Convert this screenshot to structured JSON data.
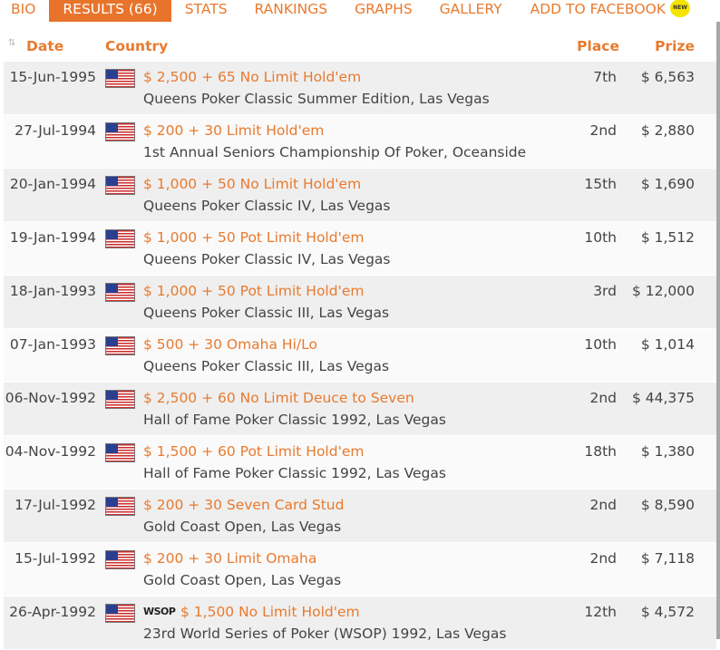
{
  "tabs": [
    {
      "label": "BIO"
    },
    {
      "label": "RESULTS (66)"
    },
    {
      "label": "STATS"
    },
    {
      "label": "RANKINGS"
    },
    {
      "label": "GRAPHS"
    },
    {
      "label": "GALLERY"
    },
    {
      "label": "ADD TO FACEBOOK"
    }
  ],
  "new_badge": "NEW",
  "headers": {
    "date": "Date",
    "country": "Country",
    "place": "Place",
    "prize": "Prize"
  },
  "rows": [
    {
      "date": "15-Jun-1995",
      "event": "$ 2,500 + 65 No Limit Hold'em",
      "venue": "Queens Poker Classic Summer Edition, Las Vegas",
      "place": "7th",
      "prize": "$ 6,563"
    },
    {
      "date": "27-Jul-1994",
      "event": "$ 200 + 30 Limit Hold'em",
      "venue": "1st Annual Seniors Championship Of Poker, Oceanside",
      "place": "2nd",
      "prize": "$ 2,880"
    },
    {
      "date": "20-Jan-1994",
      "event": "$ 1,000 + 50 No Limit Hold'em",
      "venue": "Queens Poker Classic IV, Las Vegas",
      "place": "15th",
      "prize": "$ 1,690"
    },
    {
      "date": "19-Jan-1994",
      "event": "$ 1,000 + 50 Pot Limit Hold'em",
      "venue": "Queens Poker Classic IV, Las Vegas",
      "place": "10th",
      "prize": "$ 1,512"
    },
    {
      "date": "18-Jan-1993",
      "event": "$ 1,000 + 50 Pot Limit Hold'em",
      "venue": "Queens Poker Classic III, Las Vegas",
      "place": "3rd",
      "prize": "$ 12,000"
    },
    {
      "date": "07-Jan-1993",
      "event": "$ 500 + 30 Omaha Hi/Lo",
      "venue": "Queens Poker Classic III, Las Vegas",
      "place": "10th",
      "prize": "$ 1,014"
    },
    {
      "date": "06-Nov-1992",
      "event": "$ 2,500 + 60 No Limit Deuce to Seven",
      "venue": "Hall of Fame Poker Classic 1992, Las Vegas",
      "place": "2nd",
      "prize": "$ 44,375"
    },
    {
      "date": "04-Nov-1992",
      "event": "$ 1,500 + 60 Pot Limit Hold'em",
      "venue": "Hall of Fame Poker Classic 1992, Las Vegas",
      "place": "18th",
      "prize": "$ 1,380"
    },
    {
      "date": "17-Jul-1992",
      "event": "$ 200 + 30 Seven Card Stud",
      "venue": "Gold Coast Open, Las Vegas",
      "place": "2nd",
      "prize": "$ 8,590"
    },
    {
      "date": "15-Jul-1992",
      "event": "$ 200 + 30 Limit Omaha",
      "venue": "Gold Coast Open, Las Vegas",
      "place": "2nd",
      "prize": "$ 7,118"
    },
    {
      "date": "26-Apr-1992",
      "event": "$ 1,500 No Limit Hold'em",
      "venue": "23rd World Series of Poker (WSOP) 1992, Las Vegas",
      "place": "12th",
      "prize": "$ 4,572",
      "logo": "WSOP"
    }
  ]
}
